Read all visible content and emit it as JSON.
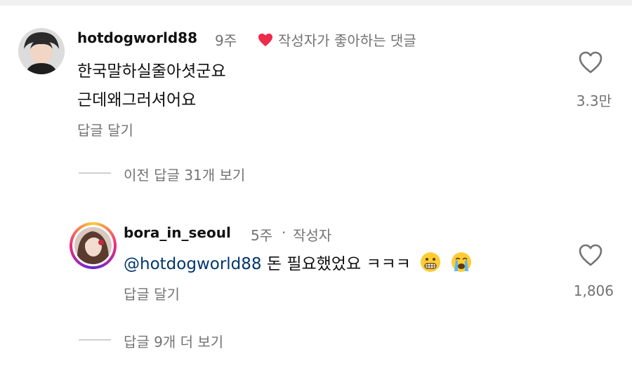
{
  "comments": [
    {
      "username": "hotdogworld88",
      "age": "9주",
      "creator_liked_label": "작성자가 좋아하는 댓글",
      "text_lines": [
        "한국말하실줄아셧군요",
        "근데왜그러셔어요"
      ],
      "reply_label": "답글 달기",
      "like_count": "3.3만",
      "view_previous_replies": "이전 답글 31개 보기"
    },
    {
      "username": "bora_in_seoul",
      "age": "5주",
      "separator": "·",
      "author_label": "작성자",
      "mention": "@hotdogworld88",
      "text": "돈 필요했었요 ㅋㅋㅋ",
      "reply_label": "답글 달기",
      "like_count": "1,806",
      "view_more_replies": "답글 9개 더 보기"
    }
  ],
  "icons": {
    "like": "heart-outline-icon",
    "creator_like": "heart-filled-icon",
    "emoji_1": "grimacing-face-emoji",
    "emoji_2": "loudly-crying-face-emoji"
  },
  "colors": {
    "creator_heart": "#ed2c4a",
    "muted_text": "#737373",
    "mention": "#00376b"
  }
}
